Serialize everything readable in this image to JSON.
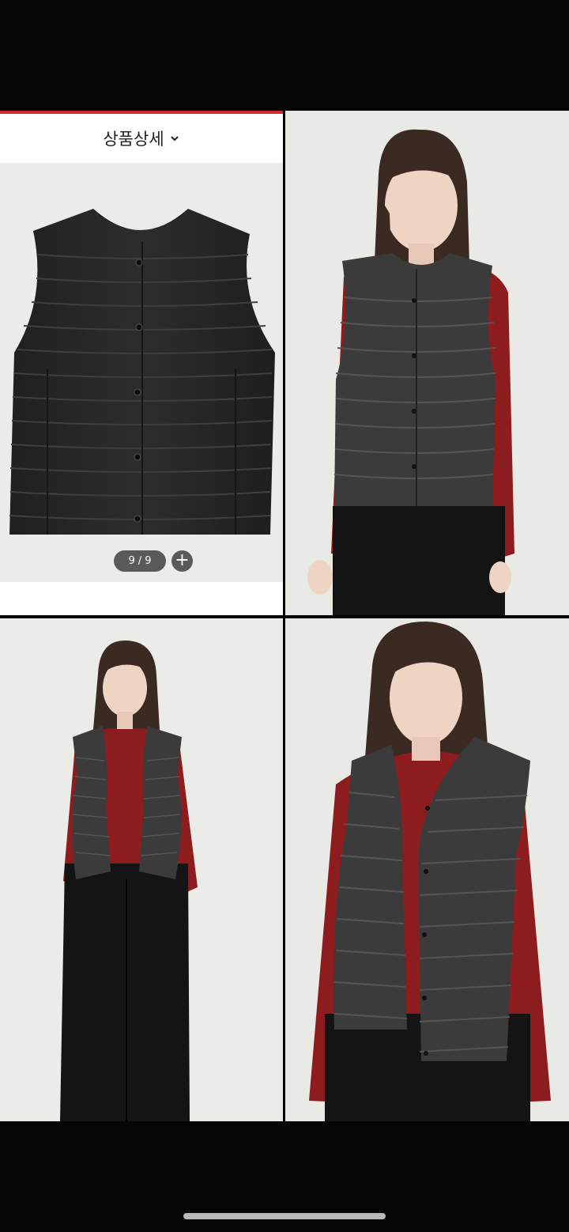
{
  "detail_header": {
    "title": "상품상세"
  },
  "pager": {
    "current": "9",
    "separator": "/",
    "total": "9"
  },
  "plus_button": {
    "label": "+"
  },
  "colors": {
    "accent_line": "#d32a2a",
    "vest": "#2b2b2b",
    "sweater": "#8c1c1e",
    "pants": "#141414",
    "background_tiles": "#e9e9e6"
  },
  "icons": [
    "chevron-down-icon",
    "plus-icon"
  ]
}
